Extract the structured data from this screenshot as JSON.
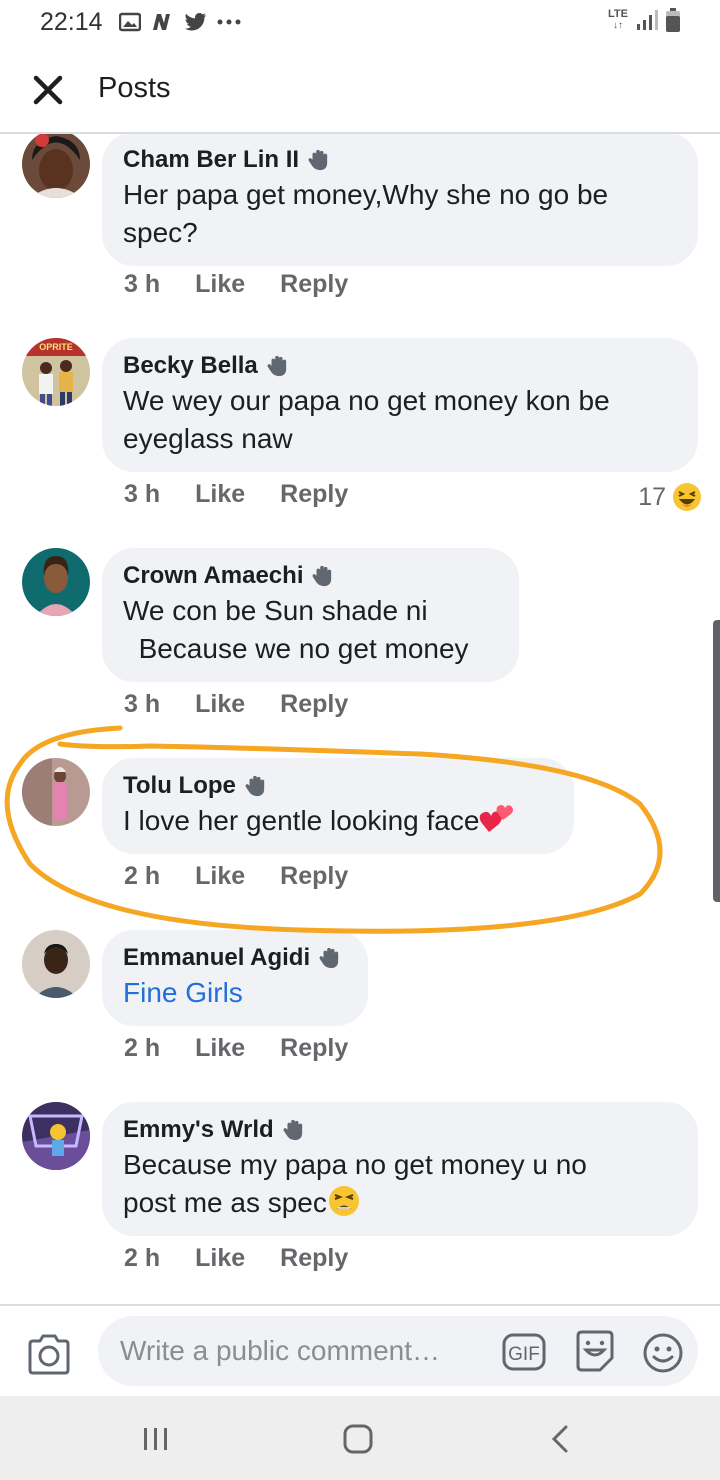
{
  "status_bar": {
    "time": "22:14",
    "network": "LTE",
    "icons": [
      "image-icon",
      "news-icon",
      "twitter-icon",
      "more-dots-icon",
      "signal-icon",
      "battery-icon"
    ]
  },
  "header": {
    "title": "Posts",
    "close_icon": "close-icon"
  },
  "comments": [
    {
      "author": "Cham Ber Lin II",
      "text": "Her papa get money,Why she no go be\nspec?",
      "time": "3 h",
      "like": "Like",
      "reply": "Reply"
    },
    {
      "author": "Becky Bella",
      "text": "We wey our papa no get money kon be\neyeglass naw",
      "time": "3 h",
      "like": "Like",
      "reply": "Reply",
      "reaction_count": "17",
      "reaction_icon": "laughing-face-icon"
    },
    {
      "author": "Crown Amaechi",
      "text": "We con be Sun shade ni\n  Because we no get money",
      "time": "3 h",
      "like": "Like",
      "reply": "Reply"
    },
    {
      "author": "Tolu Lope",
      "text": "I love her gentle looking face",
      "time": "2 h",
      "like": "Like",
      "reply": "Reply",
      "emoji": "two-hearts-icon"
    },
    {
      "author": "Emmanuel Agidi",
      "text": "Fine Girls",
      "time": "2 h",
      "like": "Like",
      "reply": "Reply",
      "text_is_link": true
    },
    {
      "author": "Emmy's Wrld",
      "text": "Because my papa no get money u no\npost me as spec",
      "time": "2 h",
      "like": "Like",
      "reply": "Reply",
      "emoji": "tired-face-icon"
    }
  ],
  "composer": {
    "placeholder": "Write a public comment…",
    "gif_label": "GIF"
  },
  "colors": {
    "bubble": "#f0f2f5",
    "link": "#216fdb",
    "meta_text": "#65676b",
    "highlight": "#f5a623"
  }
}
